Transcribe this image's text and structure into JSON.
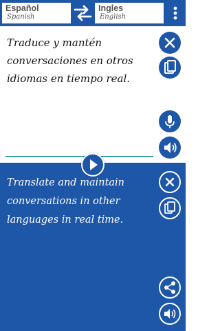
{
  "header": {
    "source_lang": "Español",
    "source_lang_sub": "Spanish",
    "target_lang": "Ingles",
    "target_lang_sub": "English",
    "icons": {
      "swap": "swap-arrows-icon",
      "menu": "more-vertical-icon"
    }
  },
  "source": {
    "text": "Traduce y mantén conversaciones en otros idiomas en tiempo real.",
    "icons": [
      "close-icon",
      "paste-icon",
      "microphone-icon",
      "speaker-icon"
    ]
  },
  "translate_icon": "play-arrow-icon",
  "target": {
    "text": "Translate and maintain conversations in other languages in real time.",
    "icons": [
      "close-icon",
      "copy-icon",
      "share-icon",
      "speaker-icon"
    ]
  },
  "colors": {
    "primary": "#1e56a8",
    "divider": "#3a9aa8",
    "panel_text_light": "#ffffff",
    "panel_text_dark": "#111111"
  }
}
